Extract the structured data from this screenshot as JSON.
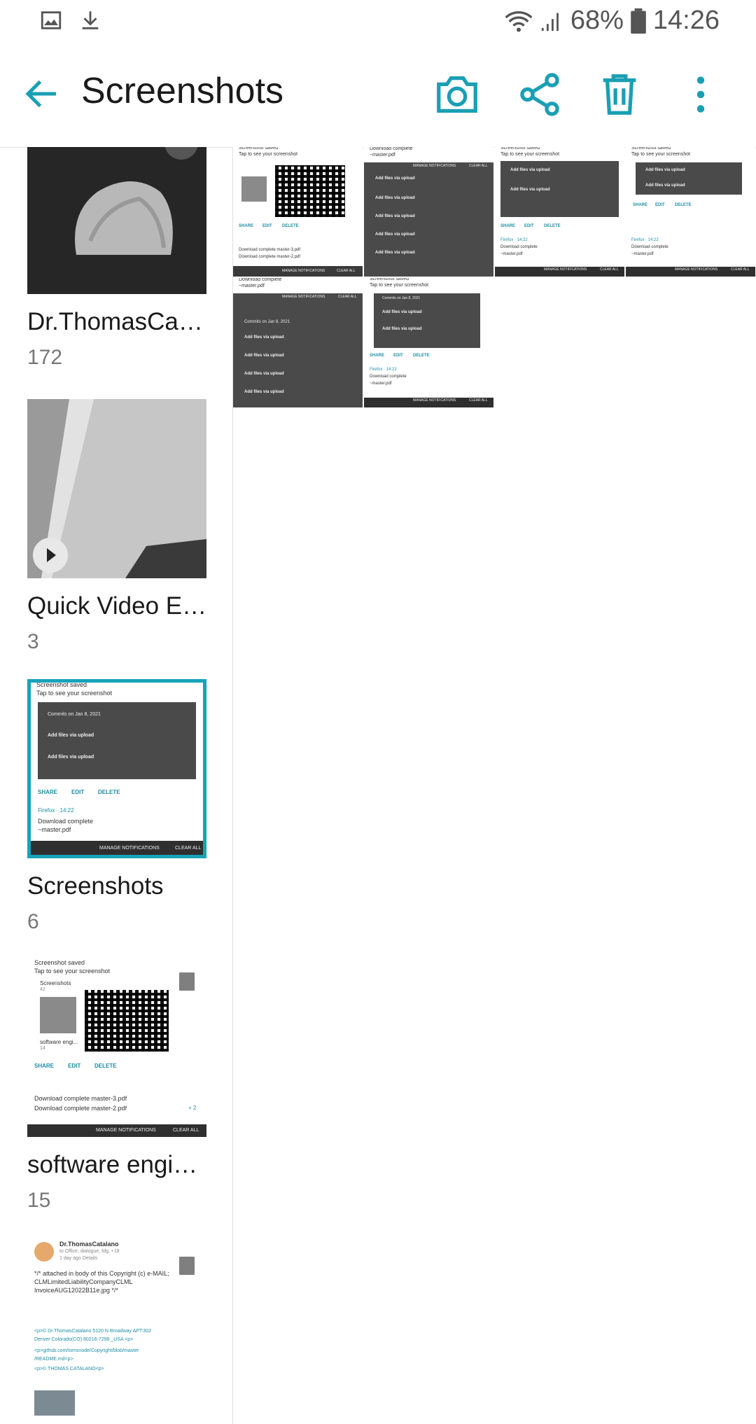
{
  "status_bar": {
    "left_icons": [
      "image-icon",
      "download-icon"
    ],
    "right_icons": [
      "wifi-icon",
      "signal-icon",
      "battery-icon"
    ],
    "battery": "68%",
    "time": "14:26"
  },
  "action_bar": {
    "title": "Screenshots",
    "icons": [
      "back-arrow-icon",
      "camera-icon",
      "share-icon",
      "trash-icon",
      "more-vert-icon"
    ]
  },
  "albums": [
    {
      "name": "Dr.ThomasCa…",
      "count": "172",
      "thumb": "rock-photo"
    },
    {
      "name": "Quick Video E…",
      "count": "3",
      "thumb": "video-still"
    },
    {
      "name": "Screenshots",
      "count": "6",
      "thumb": "notification-screenshot",
      "selected": true
    },
    {
      "name": "software engi…",
      "count": "15",
      "thumb": "qr-screenshot"
    },
    {
      "name": "",
      "count": "",
      "thumb": "email-screenshot"
    }
  ],
  "thumb_text": {
    "saved": "Screenshot saved",
    "tap": "Tap to see your screenshot",
    "share": "SHARE",
    "edit": "EDIT",
    "delete": "DELETE",
    "firefox": "Firefox · 14:22",
    "download_complete": "Download complete",
    "master_pdf": "~master.pdf",
    "dl3": "Download complete master-3.pdf",
    "dl2": "Download complete master-2.pdf",
    "plus2": "+ 2",
    "manage": "MANAGE NOTIFICATIONS",
    "clear": "CLEAR ALL",
    "add_files": "Add files via upload",
    "committed": "Commits on Jan 8, 2021",
    "screenshots_lbl": "Screenshots",
    "count42": "42",
    "software_lbl": "software engi...",
    "count14": "14",
    "email_from": "Dr.ThomasCatalano",
    "email_line1": "to Office, dialogue, fdg, +18",
    "email_line2": "1 day ago  Details",
    "email_body1": "*/* attached in body of this Copyright (c) e-MAIL;",
    "email_body2": "CLMLimitedLiabilityCompanyCLML",
    "email_body3": "InvoiceAUG12022B11e.jpg */*",
    "email_p1": "<p>© Dr.ThomasCatalano  5120 N Broadway APT:302",
    "email_p2": "Denver Colorado(CO) 80216-7299 _USA <p>",
    "email_p3": "<p>github.com/tomsnode/Copyright/blob/master",
    "email_p4": "/README.md<p>",
    "email_p5": "<p>© THOMAS CATALANO<p>"
  },
  "grid_count": 6,
  "colors": {
    "accent": "#1a9fb4",
    "selected_border": "#17a3b8",
    "dark_panel": "#4a4a4a"
  }
}
